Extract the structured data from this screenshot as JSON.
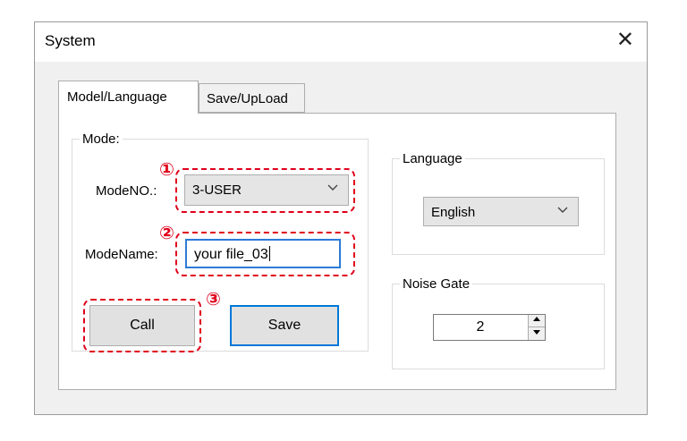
{
  "window": {
    "title": "System",
    "close_glyph": "✕"
  },
  "tabs": [
    {
      "label": "Model/Language",
      "active": true
    },
    {
      "label": "Save/UpLoad",
      "active": false
    }
  ],
  "mode_group": {
    "legend": "Mode:",
    "mode_no_label": "ModeNO.:",
    "mode_no_value": "3-USER",
    "mode_name_label": "ModeName:",
    "mode_name_value": "your file_03",
    "call_label": "Call",
    "save_label": "Save"
  },
  "language_group": {
    "legend": "Language",
    "value": "English"
  },
  "noise_gate_group": {
    "legend": "Noise Gate",
    "value": "2"
  },
  "callouts": [
    "①",
    "②",
    "③"
  ],
  "colors": {
    "callout": "#e0001b",
    "focus": "#0078d7",
    "dialog_bg": "#f0f0f0"
  },
  "icons": {
    "dropdown": "chevron-down-icon",
    "close": "close-icon",
    "spin_up": "triangle-up-icon",
    "spin_down": "triangle-down-icon"
  }
}
